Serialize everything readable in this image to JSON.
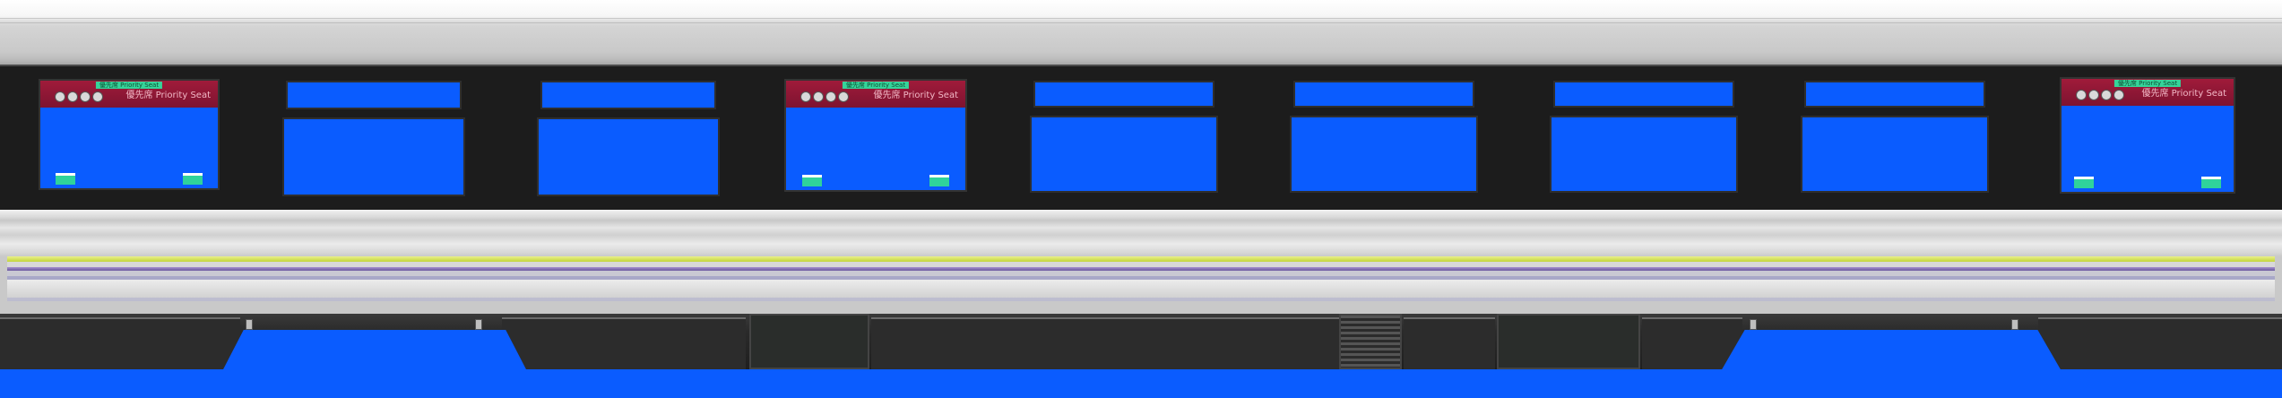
{
  "priority_seat": {
    "tag_text": "優先席 Priority Seat",
    "label_text": "優先席 Priority Seat"
  },
  "colors": {
    "window_blue": "#0a5cff",
    "priority_red": "#8f1735",
    "stripe_green": "#c8d94a",
    "stripe_purple": "#6b5a9e"
  },
  "icons": [
    "wheelchair-icon",
    "elderly-icon",
    "pregnant-icon",
    "child-icon"
  ]
}
